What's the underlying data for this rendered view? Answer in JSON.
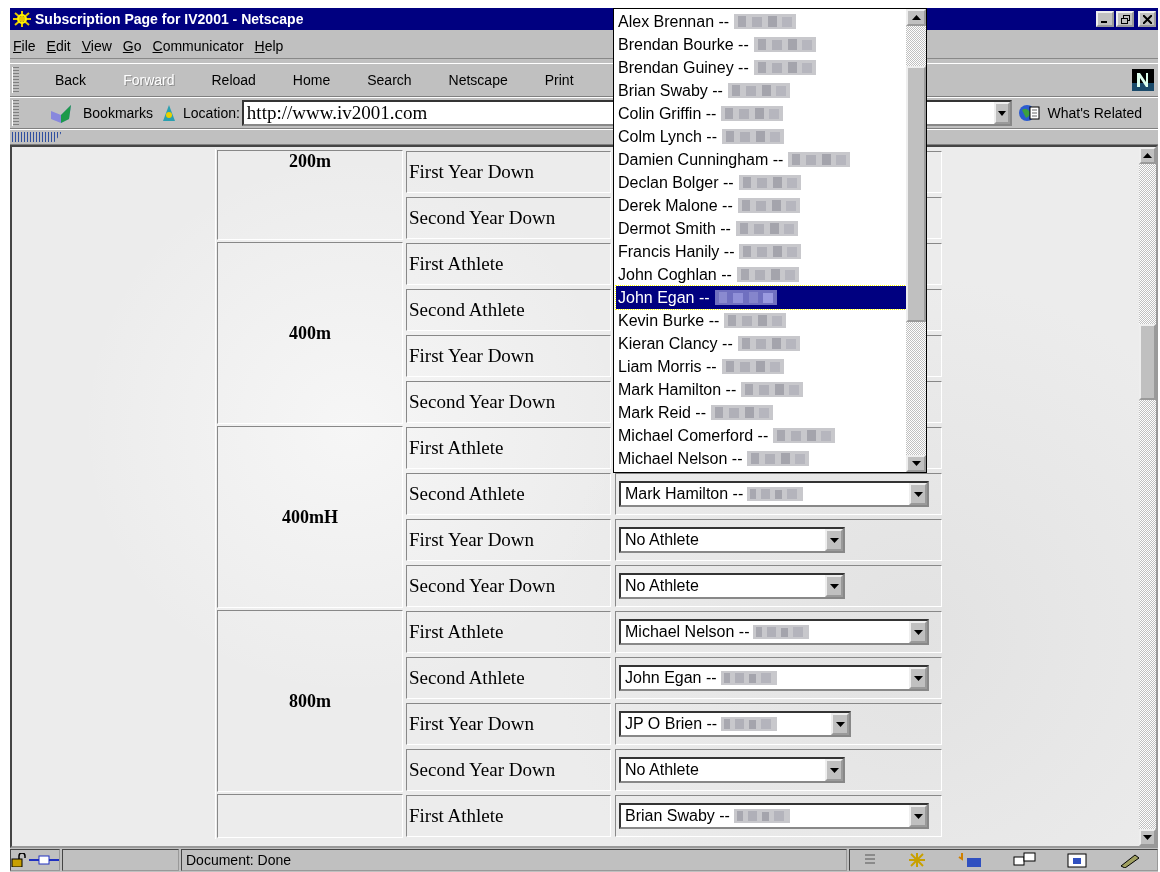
{
  "window": {
    "title": "Subscription Page for IV2001 - Netscape"
  },
  "menu": [
    {
      "label": "File"
    },
    {
      "label": "Edit"
    },
    {
      "label": "View"
    },
    {
      "label": "Go"
    },
    {
      "label": "Communicator"
    },
    {
      "label": "Help"
    }
  ],
  "toolbar": [
    {
      "label": "Back",
      "disabled": false
    },
    {
      "label": "Forward",
      "disabled": true
    },
    {
      "label": "Reload",
      "disabled": false
    },
    {
      "label": "Home",
      "disabled": false
    },
    {
      "label": "Search",
      "disabled": false
    },
    {
      "label": "Netscape",
      "disabled": false
    },
    {
      "label": "Print",
      "disabled": false
    }
  ],
  "location": {
    "bookmarks": "Bookmarks",
    "label": "Location:",
    "value": "http://www.iv2001.com",
    "related": "What's Related"
  },
  "events": [
    {
      "name": "200m",
      "rows": [
        {
          "label": "First Year Down"
        },
        {
          "label": "Second Year Down"
        }
      ]
    },
    {
      "name": "400m",
      "rows": [
        {
          "label": "First Athlete"
        },
        {
          "label": "Second Athlete"
        },
        {
          "label": "First Year Down"
        },
        {
          "label": "Second Year Down"
        }
      ]
    },
    {
      "name": "400mH",
      "rows": [
        {
          "label": "First Athlete"
        },
        {
          "label": "Second Athlete",
          "select": {
            "value": "Mark Hamilton --",
            "redacted": true,
            "kind": "wide"
          }
        },
        {
          "label": "First Year Down",
          "select": {
            "value": "No Athlete",
            "redacted": false,
            "kind": "narrow"
          }
        },
        {
          "label": "Second Year Down",
          "select": {
            "value": "No Athlete",
            "redacted": false,
            "kind": "narrow"
          }
        }
      ]
    },
    {
      "name": "800m",
      "rows": [
        {
          "label": "First Athlete",
          "select": {
            "value": "Michael Nelson --",
            "redacted": true,
            "kind": "wide"
          }
        },
        {
          "label": "Second Athlete",
          "select": {
            "value": "John Egan --",
            "redacted": true,
            "kind": "wide"
          }
        },
        {
          "label": "First Year Down",
          "select": {
            "value": "JP O Brien --",
            "redacted": true,
            "kind": "medium"
          }
        },
        {
          "label": "Second Year Down",
          "select": {
            "value": "No Athlete",
            "redacted": false,
            "kind": "narrow"
          }
        }
      ]
    },
    {
      "rows": [
        {
          "label": "First Athlete",
          "select": {
            "value": "Brian Swaby --",
            "redacted": true,
            "kind": "wide"
          }
        }
      ]
    }
  ],
  "dropdown": {
    "options": [
      {
        "label": "Alex Brennan --",
        "selected": false
      },
      {
        "label": "Brendan Bourke --",
        "selected": false
      },
      {
        "label": "Brendan Guiney --",
        "selected": false
      },
      {
        "label": "Brian Swaby --",
        "selected": false
      },
      {
        "label": "Colin Griffin --",
        "selected": false
      },
      {
        "label": "Colm Lynch --",
        "selected": false
      },
      {
        "label": "Damien Cunningham --",
        "selected": false
      },
      {
        "label": "Declan Bolger --",
        "selected": false
      },
      {
        "label": "Derek Malone --",
        "selected": false
      },
      {
        "label": "Dermot Smith --",
        "selected": false
      },
      {
        "label": "Francis Hanily --",
        "selected": false
      },
      {
        "label": "John Coghlan --",
        "selected": false
      },
      {
        "label": "John Egan --",
        "selected": true
      },
      {
        "label": "Kevin Burke --",
        "selected": false
      },
      {
        "label": "Kieran Clancy --",
        "selected": false
      },
      {
        "label": "Liam Morris --",
        "selected": false
      },
      {
        "label": "Mark Hamilton --",
        "selected": false
      },
      {
        "label": "Mark Reid --",
        "selected": false
      },
      {
        "label": "Michael Comerford --",
        "selected": false
      },
      {
        "label": "Michael Nelson --",
        "selected": false
      }
    ]
  },
  "status": {
    "text": "Document: Done"
  }
}
